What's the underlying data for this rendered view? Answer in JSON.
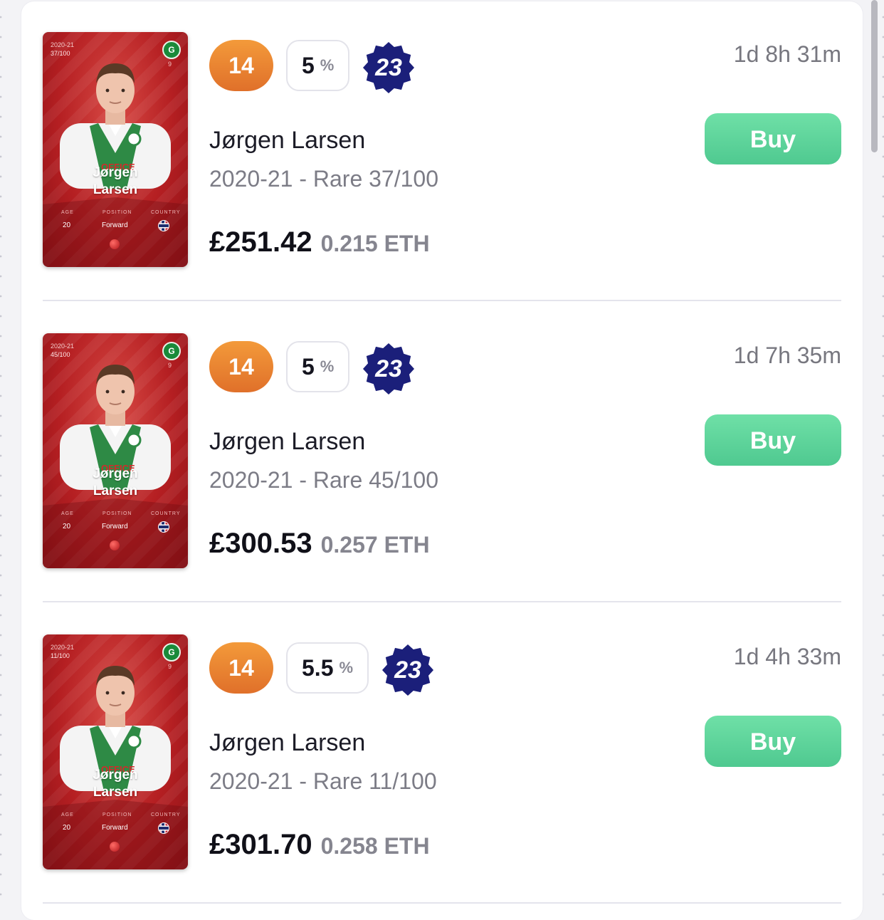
{
  "listings": [
    {
      "card": {
        "season": "2020-21",
        "serial": "37/100",
        "shirt_number": "9",
        "name_line1": "Jørgen",
        "name_line2": "Larsen",
        "age_label": "AGE",
        "age": "20",
        "position_label": "POSITION",
        "position": "Forward",
        "country_label": "COUNTRY"
      },
      "level": "14",
      "bonus_value": "5",
      "bonus_unit": "%",
      "score": "23",
      "time_left": "1d 8h 31m",
      "buy_label": "Buy",
      "player_name": "Jørgen Larsen",
      "meta": "2020-21 - Rare 37/100",
      "price_fiat": "£251.42",
      "price_eth": "0.215 ETH"
    },
    {
      "card": {
        "season": "2020-21",
        "serial": "45/100",
        "shirt_number": "9",
        "name_line1": "Jørgen",
        "name_line2": "Larsen",
        "age_label": "AGE",
        "age": "20",
        "position_label": "POSITION",
        "position": "Forward",
        "country_label": "COUNTRY"
      },
      "level": "14",
      "bonus_value": "5",
      "bonus_unit": "%",
      "score": "23",
      "time_left": "1d 7h 35m",
      "buy_label": "Buy",
      "player_name": "Jørgen Larsen",
      "meta": "2020-21 - Rare 45/100",
      "price_fiat": "£300.53",
      "price_eth": "0.257 ETH"
    },
    {
      "card": {
        "season": "2020-21",
        "serial": "11/100",
        "shirt_number": "9",
        "name_line1": "Jørgen",
        "name_line2": "Larsen",
        "age_label": "AGE",
        "age": "20",
        "position_label": "POSITION",
        "position": "Forward",
        "country_label": "COUNTRY"
      },
      "level": "14",
      "bonus_value": "5.5",
      "bonus_unit": "%",
      "score": "23",
      "time_left": "1d 4h 33m",
      "buy_label": "Buy",
      "player_name": "Jørgen Larsen",
      "meta": "2020-21 - Rare 11/100",
      "price_fiat": "£301.70",
      "price_eth": "0.258 ETH"
    }
  ],
  "colors": {
    "level_badge": "#e8822f",
    "score_badge": "#1b1f7a",
    "buy_button": "#5cd49b",
    "card_red": "#b51f22"
  },
  "icons": {
    "percent": "percent-icon",
    "score": "star-badge-icon",
    "club": "club-crest-icon",
    "flag": "norway-flag-icon"
  }
}
